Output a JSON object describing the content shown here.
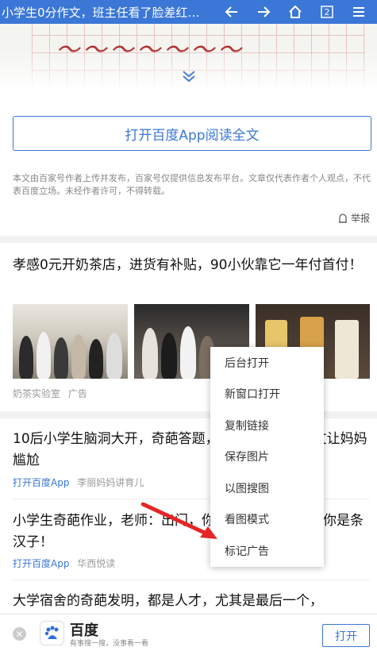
{
  "topbar": {
    "title": "小学生0分作文，班主任看了脸差红…",
    "page_count": "2"
  },
  "article": {
    "open_full_label": "打开百度App阅读全文",
    "disclaimer": "本文由百家号作者上传并发布，百家号仅提供信息发布平台。文章仅代表作者个人观点，不代表百度立场。未经作者许可，不得转载。",
    "report_label": "举报"
  },
  "ad": {
    "title": "孝感0元开奶茶店，进货有补贴，90小伙靠它一年付首付！",
    "source": "奶茶实验室",
    "tag": "广告"
  },
  "news": [
    {
      "title": "10后小学生脑洞大开，奇葩答题，小学生最后的作文让妈妈尴尬",
      "app_label": "打开百度App",
      "source": "李丽妈妈讲育儿"
    },
    {
      "title": "小学生奇葩作业，老师：出门，你是下不家网友：敬你是条汉子！",
      "app_label": "打开百度App",
      "source": "华西悦读"
    },
    {
      "title": "大学宿舍的奇葩发明，都是人才，尤其是最后一个，"
    }
  ],
  "context_menu": {
    "items": [
      "后台打开",
      "新窗口打开",
      "复制链接",
      "保存图片",
      "以图搜图",
      "看图模式",
      "标记广告"
    ]
  },
  "bottombar": {
    "brand": "百度",
    "slogan": "有事搜一搜，没事看一看",
    "open_label": "打开"
  },
  "colors": {
    "accent": "#3b77d6",
    "annotation_arrow": "#e52525"
  }
}
